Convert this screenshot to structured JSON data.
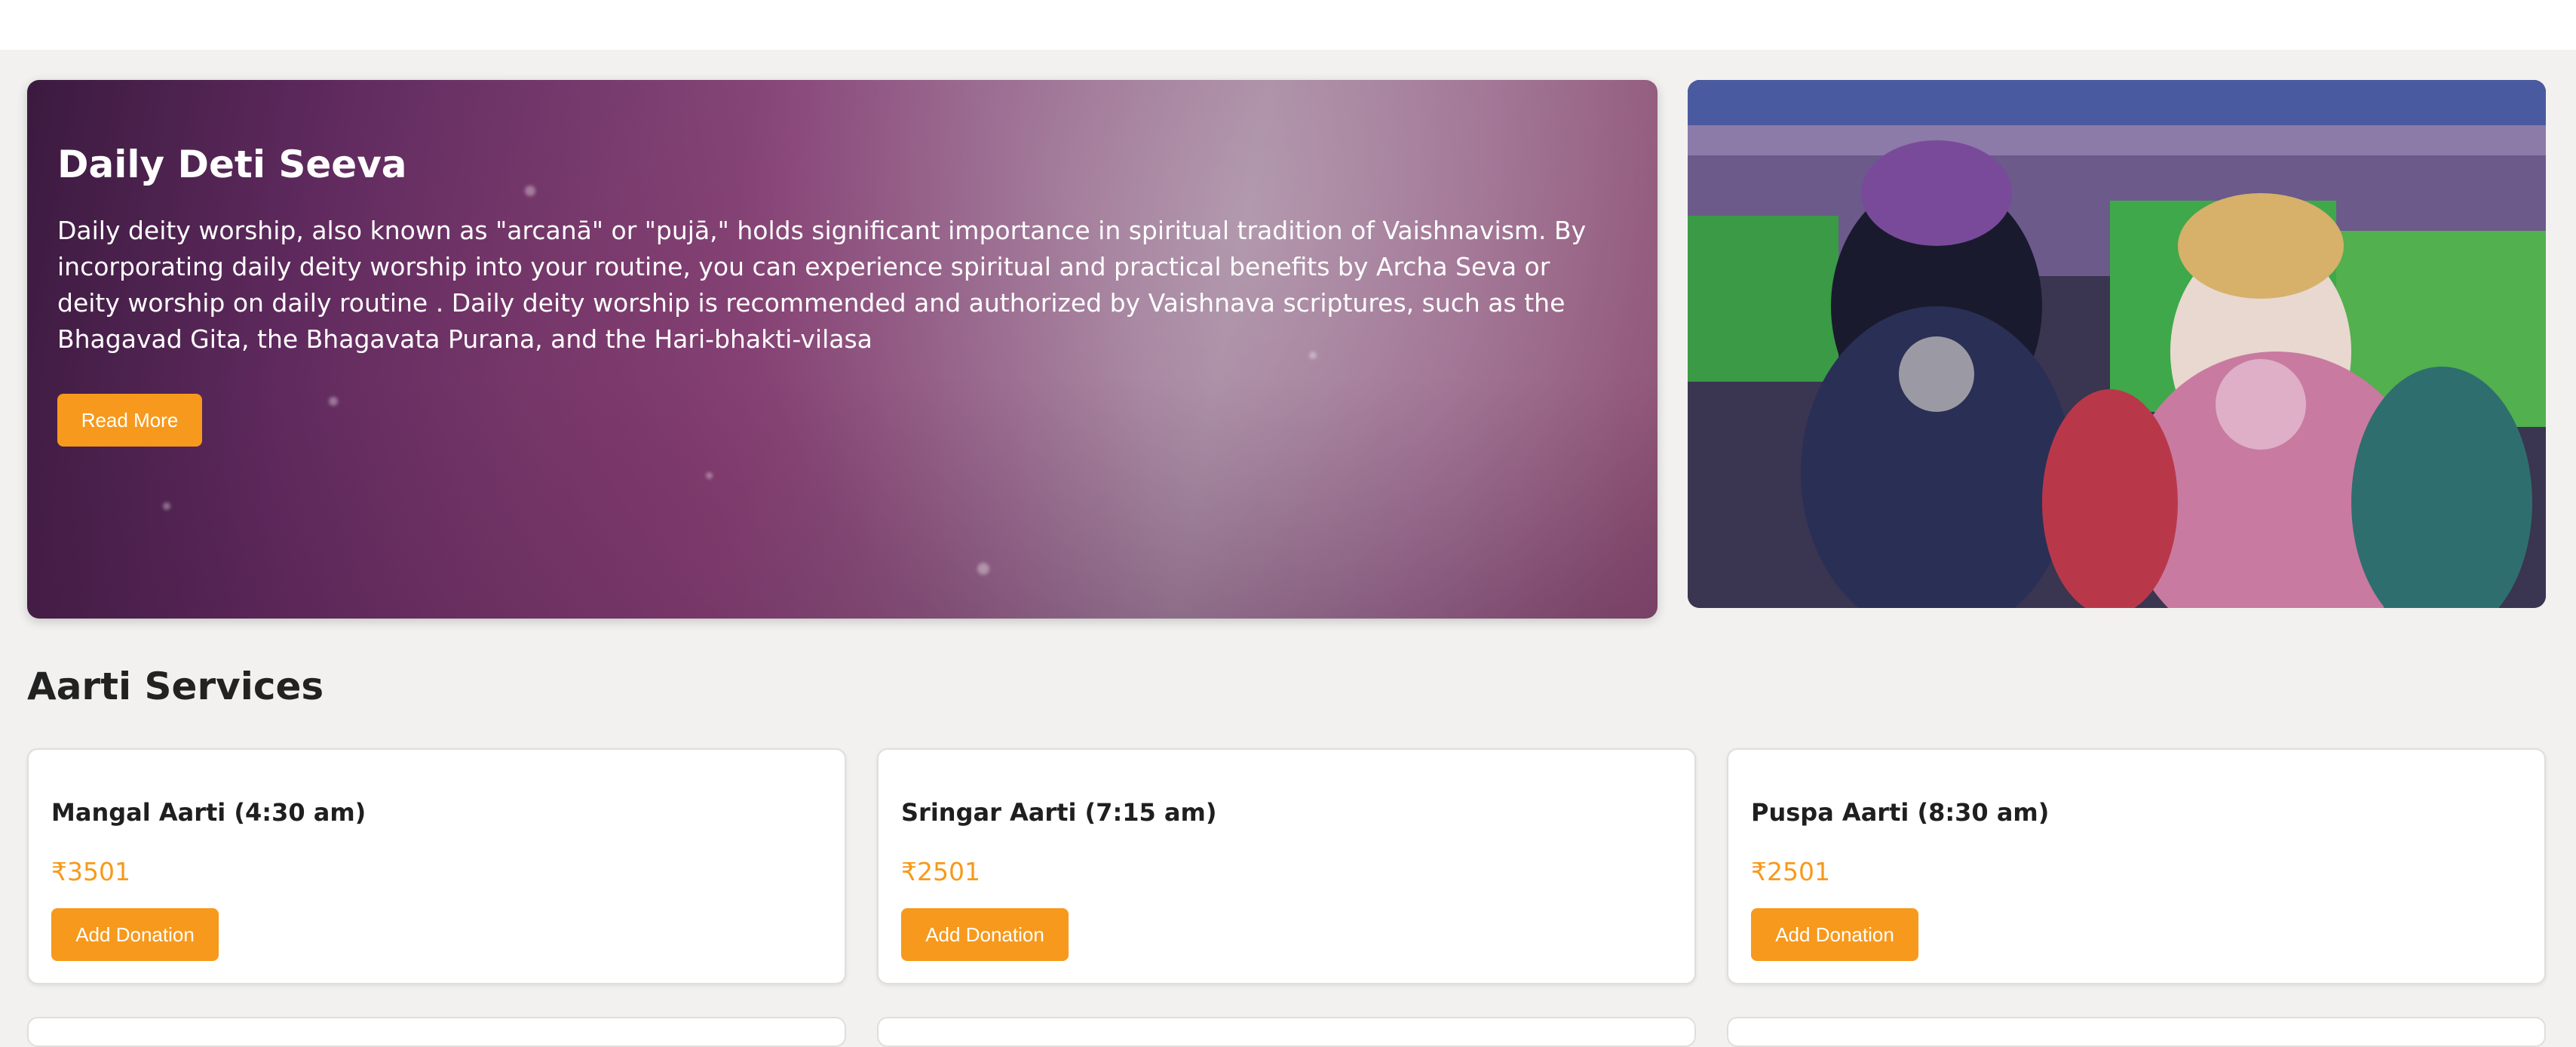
{
  "hero": {
    "title": "Daily Deti Seeva",
    "text": "Daily deity worship, also known as \"arcanā\" or \"pujā,\" holds significant importance in spiritual tradition of Vaishnavism. By incorporating daily deity worship into your routine, you can experience spiritual and practical benefits by Archa Seva or deity worship on daily routine . Daily deity worship is recommended and authorized by Vaishnava scriptures, such as the Bhagavad Gita, the Bhagavata Purana, and the Hari-bhakti-vilasa",
    "read_more_label": "Read More"
  },
  "deity_image": {
    "icon": "deity-photo"
  },
  "section": {
    "title": "Aarti Services"
  },
  "services": [
    {
      "title": "Mangal Aarti (4:30 am)",
      "price": "₹3501",
      "button_label": "Add Donation"
    },
    {
      "title": "Sringar Aarti (7:15 am)",
      "price": "₹2501",
      "button_label": "Add Donation"
    },
    {
      "title": "Puspa Aarti (8:30 am)",
      "price": "₹2501",
      "button_label": "Add Donation"
    }
  ],
  "colors": {
    "accent": "#f7991c",
    "hero_dark": "#3b1a3f",
    "hero_light": "#a2839c",
    "background": "#f2f1f0"
  }
}
